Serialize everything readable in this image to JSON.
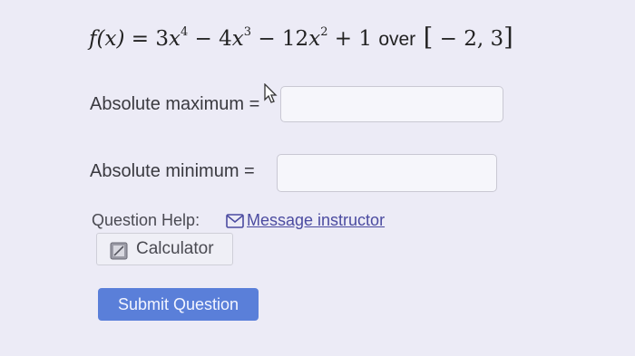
{
  "question": {
    "fx": "f(x)",
    "eq": " = 3",
    "x1": "x",
    "p1": "4",
    "t2a": " − 4",
    "x2": "x",
    "p2": "3",
    "t3a": " − 12",
    "x3": "x",
    "p3": "2",
    "t4": " + 1 ",
    "over": "over",
    "lb": " [",
    "interval": " − 2, 3",
    "rb": "]"
  },
  "answers": {
    "max_label": "Absolute maximum =",
    "max_value": "",
    "min_label": "Absolute minimum =",
    "min_value": ""
  },
  "help": {
    "label": "Question Help:",
    "message_link": "Message instructor",
    "calculator_label": "Calculator"
  },
  "submit_label": "Submit Question"
}
